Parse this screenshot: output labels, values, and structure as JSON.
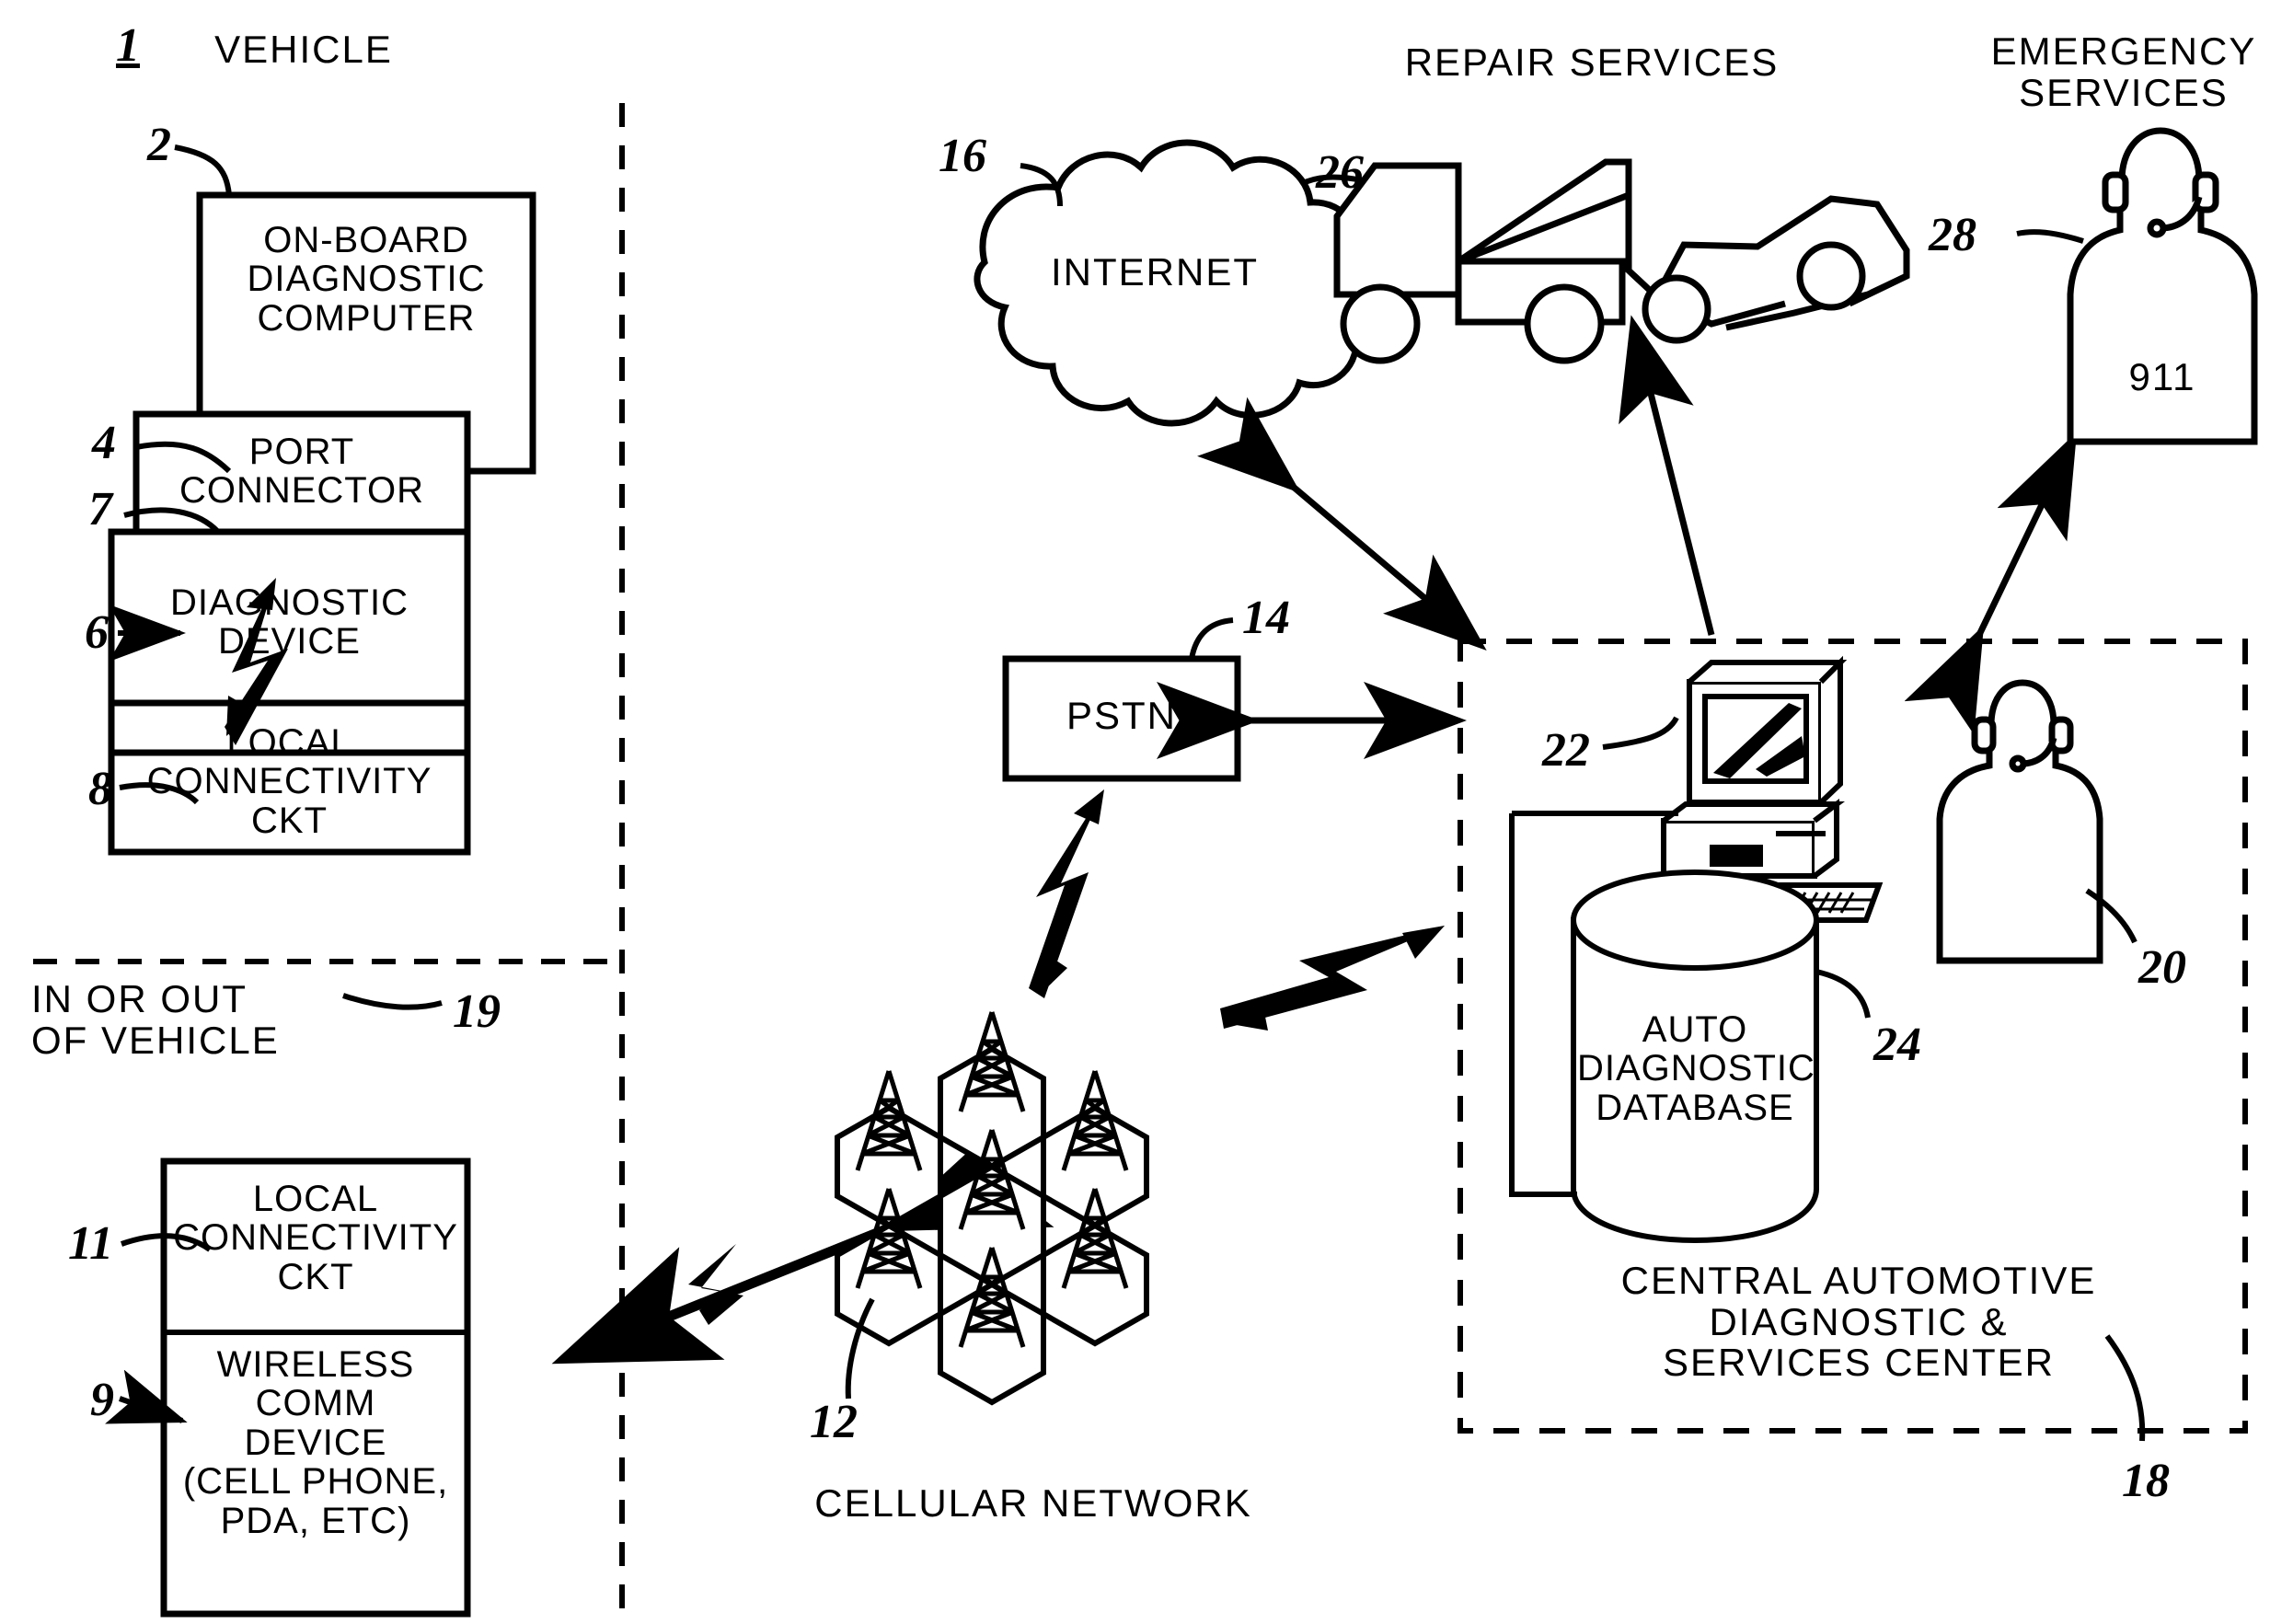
{
  "figure": {
    "figure_number": "1",
    "title_vehicle": "VEHICLE",
    "boundary_note": "IN OR OUT\nOF VEHICLE"
  },
  "vehicle_blocks": [
    {
      "id": "on-board-diagnostic-computer",
      "ref": "2",
      "label": "ON-BOARD\nDIAGNOSTIC\nCOMPUTER"
    },
    {
      "id": "port-connector",
      "ref": "4",
      "ref2": "7",
      "label": "PORT\nCONNECTOR"
    },
    {
      "id": "diagnostic-device",
      "ref": "6",
      "label": "DIAGNOSTIC\nDEVICE"
    },
    {
      "id": "local-connectivity-ckt-upper",
      "ref": "8",
      "label": "LOCAL\nCONNECTIVITY\nCKT"
    },
    {
      "id": "local-connectivity-ckt-lower",
      "ref": "11",
      "label": "LOCAL\nCONNECTIVITY\nCKT"
    },
    {
      "id": "wireless-comm-device",
      "ref": "9",
      "label": "WIRELESS\nCOMM\nDEVICE\n(CELL PHONE,\nPDA, ETC)"
    }
  ],
  "network": {
    "internet_label": "INTERNET",
    "internet_ref": "16",
    "pstn_label": "PSTN",
    "pstn_ref": "14",
    "cellular_label": "CELLULAR NETWORK",
    "cellular_ref": "12",
    "wireless_link_ref": "19"
  },
  "services": {
    "repair_label": "REPAIR SERVICES",
    "repair_ref": "26",
    "emergency_label": "EMERGENCY\nSERVICES",
    "emergency_ref": "28",
    "emergency_badge": "911"
  },
  "center": {
    "title": "CENTRAL AUTOMOTIVE\nDIAGNOSTIC &\nSERVICES CENTER",
    "ref": "18",
    "computer_ref": "22",
    "operator_ref": "20",
    "database_label": "AUTO\nDIAGNOSTIC\nDATABASE",
    "database_ref": "24"
  },
  "colors": {
    "ink": "#000000",
    "paper": "#ffffff"
  }
}
